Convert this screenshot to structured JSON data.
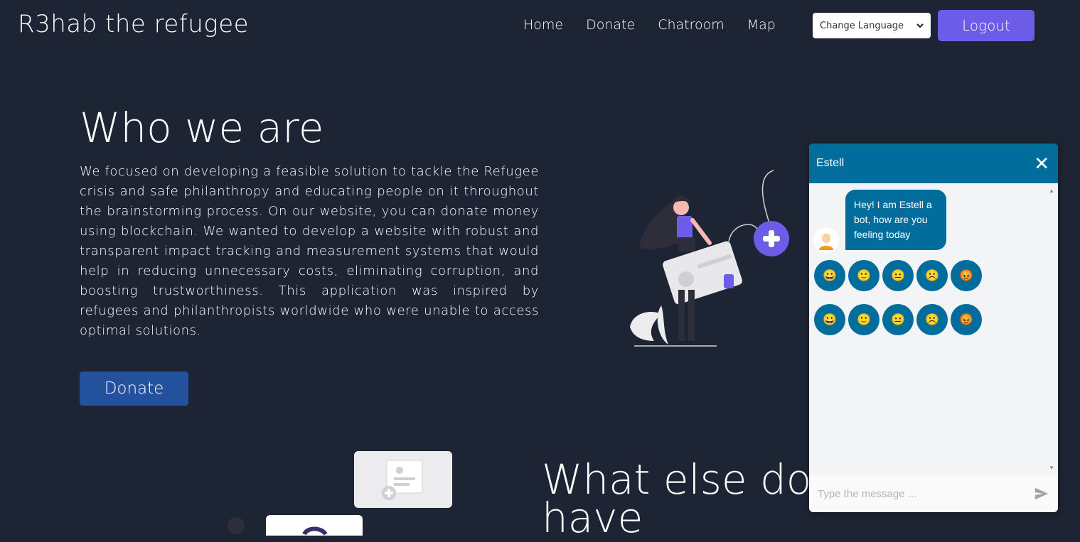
{
  "header": {
    "brand": "R3hab the refugee",
    "nav": [
      "Home",
      "Donate",
      "Chatroom",
      "Map"
    ],
    "language_select": "Change Language",
    "logout_label": "Logout"
  },
  "hero": {
    "title": "Who we are",
    "description": "We focused on developing a feasible solution to tackle the Refugee crisis and safe philanthropy and educating people on it throughout the brainstorming process. On our website, you can donate money using blockchain. We wanted to develop a website with robust and transparent impact tracking and measurement systems that would help in reducing unnecessary costs, eliminating corruption, and boosting trustworthiness. This application was inspired by refugees and philanthropists worldwide who were unable to access optimal solutions.",
    "donate_label": "Donate"
  },
  "section2": {
    "title": "What else do we have"
  },
  "chat": {
    "bot_name": "Estell",
    "message": "Hey! I am Estell a bot, how are you feeling today",
    "emoji_rows": [
      [
        "😀",
        "🙂",
        "😐",
        "☹️",
        "😡"
      ],
      [
        "😀",
        "🙂",
        "😐",
        "☹️",
        "😡"
      ]
    ],
    "input_placeholder": "Type the message ..."
  },
  "colors": {
    "background": "#1d2433",
    "accent_purple": "#6c5ce7",
    "donate_blue": "#24519e",
    "chat_blue": "#006d9c"
  }
}
